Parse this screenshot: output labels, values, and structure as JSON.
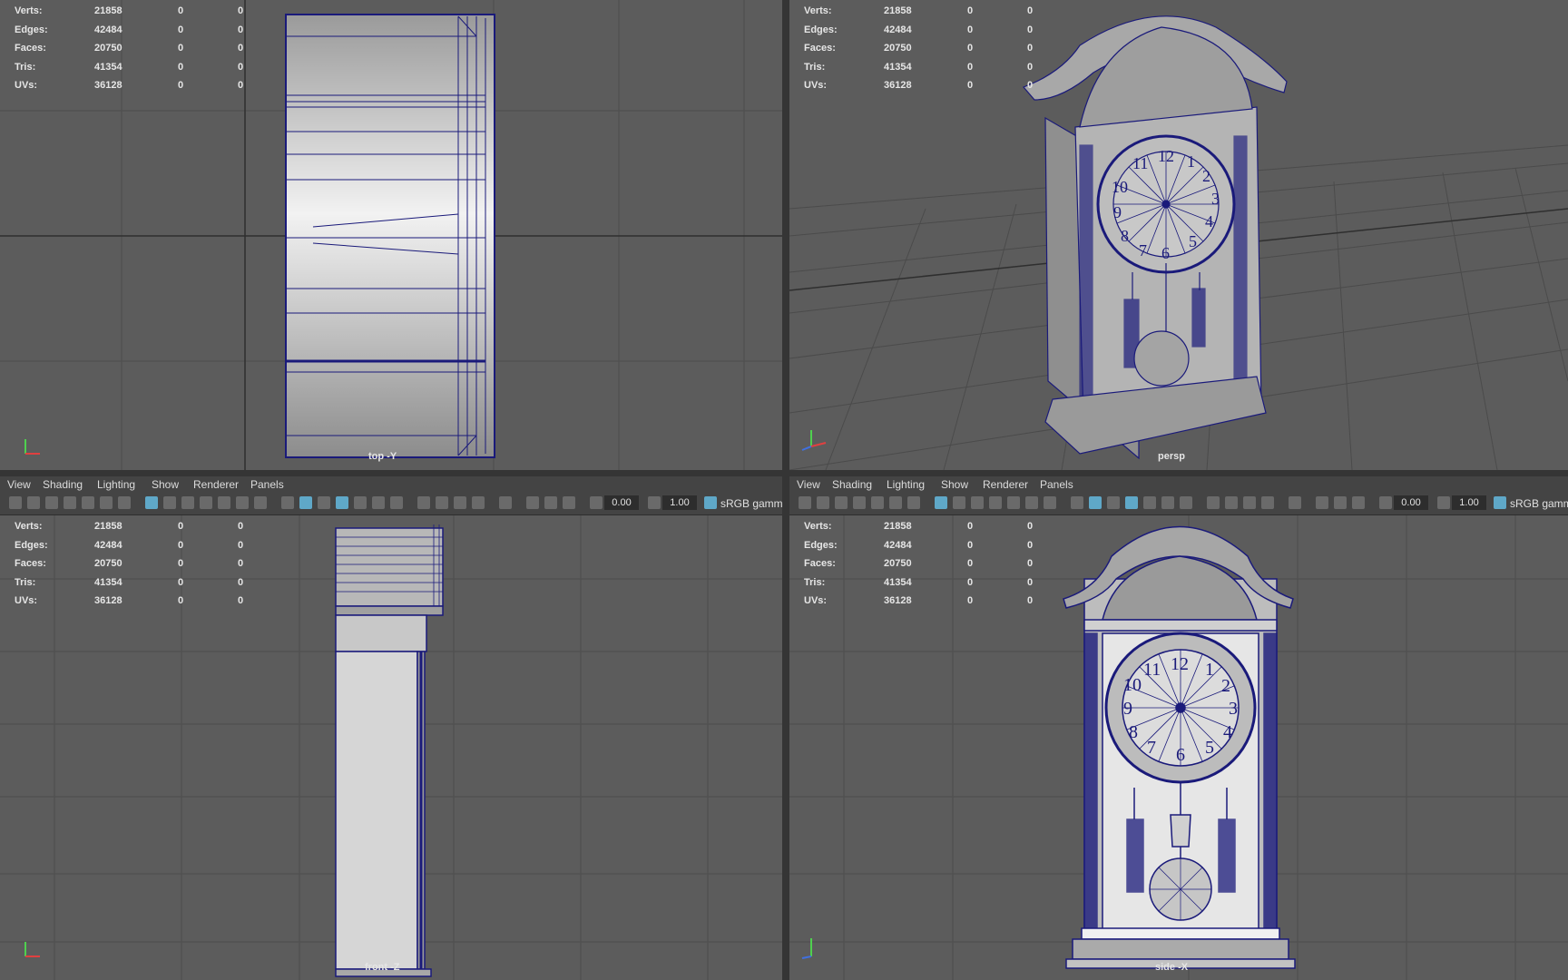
{
  "stats": [
    {
      "label": "Verts:",
      "v1": "21858",
      "v2": "0",
      "v3": "0"
    },
    {
      "label": "Edges:",
      "v1": "42484",
      "v2": "0",
      "v3": "0"
    },
    {
      "label": "Faces:",
      "v1": "20750",
      "v2": "0",
      "v3": "0"
    },
    {
      "label": "Tris:",
      "v1": "41354",
      "v2": "0",
      "v3": "0"
    },
    {
      "label": "UVs:",
      "v1": "36128",
      "v2": "0",
      "v3": "0"
    }
  ],
  "viewports": {
    "top": {
      "camera": "top -Y"
    },
    "persp": {
      "camera": "persp"
    },
    "front": {
      "camera": "front -Z"
    },
    "side": {
      "camera": "side -X"
    }
  },
  "menus": [
    "View",
    "Shading",
    "Lighting",
    "Show",
    "Renderer",
    "Panels"
  ],
  "toolbar": {
    "exposure": "0.00",
    "gamma": "1.00",
    "color_space": "sRGB gamm"
  },
  "clock_numerals": [
    "12",
    "1",
    "2",
    "3",
    "4",
    "5",
    "6",
    "7",
    "8",
    "9",
    "10",
    "11"
  ],
  "icons": [
    "camera-icon",
    "bookmark-icon",
    "grid-icon",
    "wireframe-icon",
    "smooth-shade-icon",
    "texture-icon",
    "light-icon",
    "isolate-icon",
    "exposure-icon",
    "gamma-icon",
    "color-management-icon"
  ],
  "colors": {
    "viewport": "#5c5c5c",
    "wire": "#1a1a7a",
    "chrome": "#444444",
    "active_toggle": "#5fa8c8"
  }
}
